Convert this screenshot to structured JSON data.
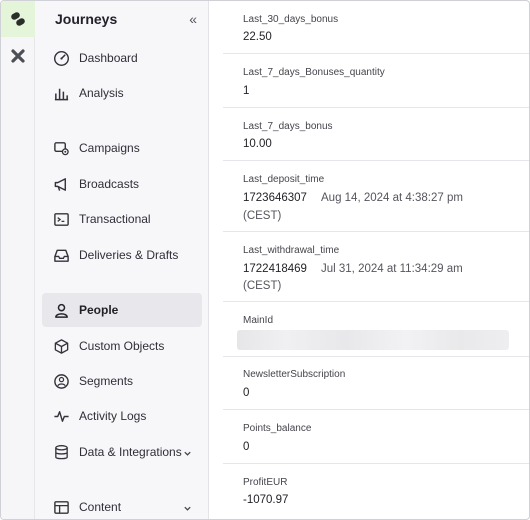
{
  "app": {
    "title": "Journeys",
    "collapse_glyph": "«"
  },
  "colors": {
    "brand_tile": "#e4f5d9",
    "active_bg": "#e8e8ec"
  },
  "nav": [
    {
      "label": "Dashboard",
      "icon": "dashboard-gauge-icon"
    },
    {
      "label": "Analysis",
      "icon": "bar-chart-icon"
    },
    {
      "label": "Campaigns",
      "icon": "campaigns-icon"
    },
    {
      "label": "Broadcasts",
      "icon": "megaphone-icon"
    },
    {
      "label": "Transactional",
      "icon": "terminal-icon"
    },
    {
      "label": "Deliveries & Drafts",
      "icon": "inbox-tray-icon"
    },
    {
      "label": "People",
      "icon": "person-icon",
      "active": true
    },
    {
      "label": "Custom Objects",
      "icon": "cube-icon"
    },
    {
      "label": "Segments",
      "icon": "segments-icon"
    },
    {
      "label": "Activity Logs",
      "icon": "pulse-icon"
    },
    {
      "label": "Data & Integrations",
      "icon": "database-icon",
      "has_chevron": true
    },
    {
      "label": "Content",
      "icon": "layout-icon",
      "has_chevron": true
    }
  ],
  "attributes": [
    {
      "label": "Last_30_days_bonus",
      "value": "22.50"
    },
    {
      "label": "Last_7_days_Bonuses_quantity",
      "value": "1"
    },
    {
      "label": "Last_7_days_bonus",
      "value": "10.00"
    },
    {
      "label": "Last_deposit_time",
      "value": "1723646307",
      "value_formatted": "Aug 14, 2024 at 4:38:27 pm",
      "value_tz": "(CEST)"
    },
    {
      "label": "Last_withdrawal_time",
      "value": "1722418469",
      "value_formatted": "Jul 31, 2024 at 11:34:29 am",
      "value_tz": "(CEST)"
    },
    {
      "label": "MainId",
      "value": "",
      "redacted": true
    },
    {
      "label": "NewsletterSubscription",
      "value": "0"
    },
    {
      "label": "Points_balance",
      "value": "0"
    },
    {
      "label": "ProfitEUR",
      "value": "-1070.97"
    }
  ]
}
